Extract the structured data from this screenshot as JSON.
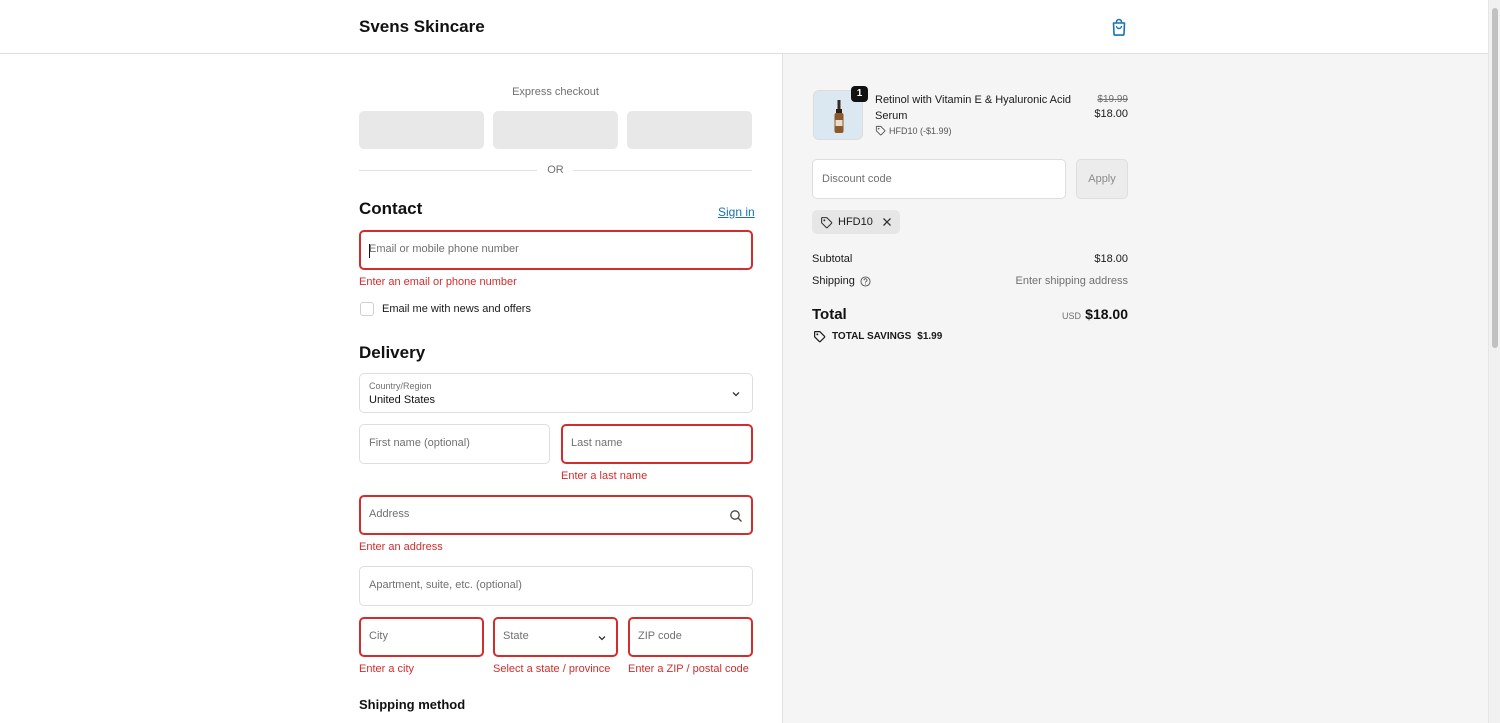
{
  "header": {
    "brand": "Svens Skincare",
    "cart_icon": "shopping-bag-icon"
  },
  "express": {
    "label": "Express checkout",
    "or": "OR"
  },
  "contact": {
    "title": "Contact",
    "sign_in": "Sign in",
    "email_placeholder": "Email or mobile phone number",
    "email_error": "Enter an email or phone number",
    "newsletter_label": "Email me with news and offers"
  },
  "delivery": {
    "title": "Delivery",
    "country_label": "Country/Region",
    "country_value": "United States",
    "first_name_placeholder": "First name (optional)",
    "last_name_placeholder": "Last name",
    "last_name_error": "Enter a last name",
    "address_placeholder": "Address",
    "address_error": "Enter an address",
    "apartment_placeholder": "Apartment, suite, etc. (optional)",
    "city_placeholder": "City",
    "city_error": "Enter a city",
    "state_placeholder": "State",
    "state_error": "Select a state / province",
    "zip_placeholder": "ZIP code",
    "zip_error": "Enter a ZIP / postal code"
  },
  "shipping_method": {
    "title": "Shipping method"
  },
  "summary": {
    "product": {
      "name": "Retinol with Vitamin E & Hyaluronic Acid Serum",
      "quantity": "1",
      "discount": "HFD10 (-$1.99)",
      "original_price": "$19.99",
      "price": "$18.00"
    },
    "discount_placeholder": "Discount code",
    "apply_label": "Apply",
    "applied_code": "HFD10",
    "subtotal_label": "Subtotal",
    "subtotal_value": "$18.00",
    "shipping_label": "Shipping",
    "shipping_value": "Enter shipping address",
    "total_label": "Total",
    "currency": "USD",
    "total_value": "$18.00",
    "savings_label": "TOTAL SAVINGS",
    "savings_value": "$1.99"
  },
  "colors": {
    "error": "#d12d2d",
    "link": "#1773b0",
    "summary_bg": "#f5f5f5"
  }
}
